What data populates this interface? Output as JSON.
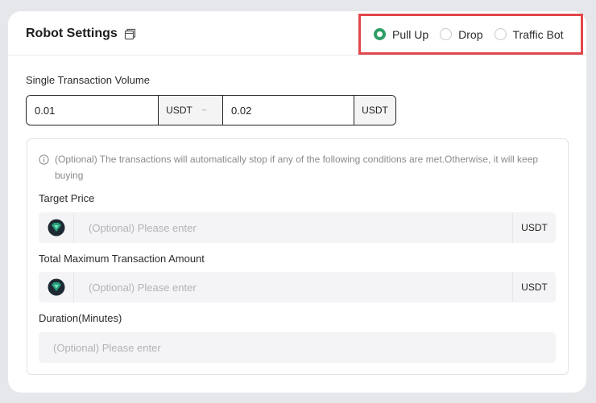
{
  "header": {
    "title": "Robot Settings",
    "copy_icon": "copy-icon"
  },
  "modes": [
    {
      "label": "Pull Up",
      "checked": true
    },
    {
      "label": "Drop",
      "checked": false
    },
    {
      "label": "Traffic Bot",
      "checked": false
    }
  ],
  "volume": {
    "label": "Single Transaction Volume",
    "min_value": "0.01",
    "min_unit": "USDT",
    "separator": "~",
    "max_value": "0.02",
    "max_unit": "USDT"
  },
  "conditions": {
    "notice": "(Optional) The transactions will automatically stop if any of the following conditions are met.Otherwise, it will keep buying",
    "target_price": {
      "label": "Target Price",
      "placeholder": "(Optional) Please enter",
      "unit": "USDT"
    },
    "total_amount": {
      "label": "Total Maximum Transaction Amount",
      "placeholder": "(Optional) Please enter",
      "unit": "USDT"
    },
    "duration": {
      "label": "Duration(Minutes)",
      "placeholder": "(Optional) Please enter"
    }
  },
  "colors": {
    "accent": "#2f9e68",
    "highlight_border": "#e0474c",
    "coin": "#26a17b"
  }
}
